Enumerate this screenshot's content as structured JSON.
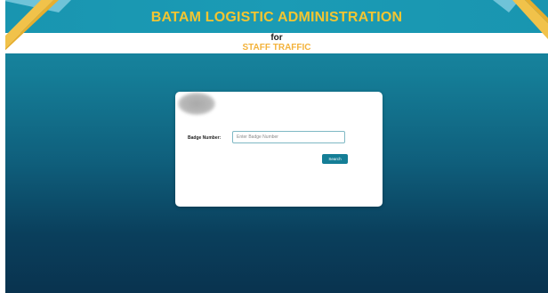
{
  "header": {
    "title": "BATAM LOGISTIC ADMINISTRATION",
    "subtitle_line1": "for",
    "subtitle_line2": "STAFF TRAFFIC"
  },
  "form": {
    "badge_label": "Badge Number:",
    "badge_placeholder": "Enter Badge Number",
    "badge_value": "",
    "search_button_label": "Search"
  },
  "colors": {
    "title_gold": "#f3c531",
    "staff_orange": "#f3b23a",
    "band_teal": "#1995b0",
    "button_teal": "#147e96"
  },
  "icons": {
    "logo": "blurred-logo-icon"
  }
}
